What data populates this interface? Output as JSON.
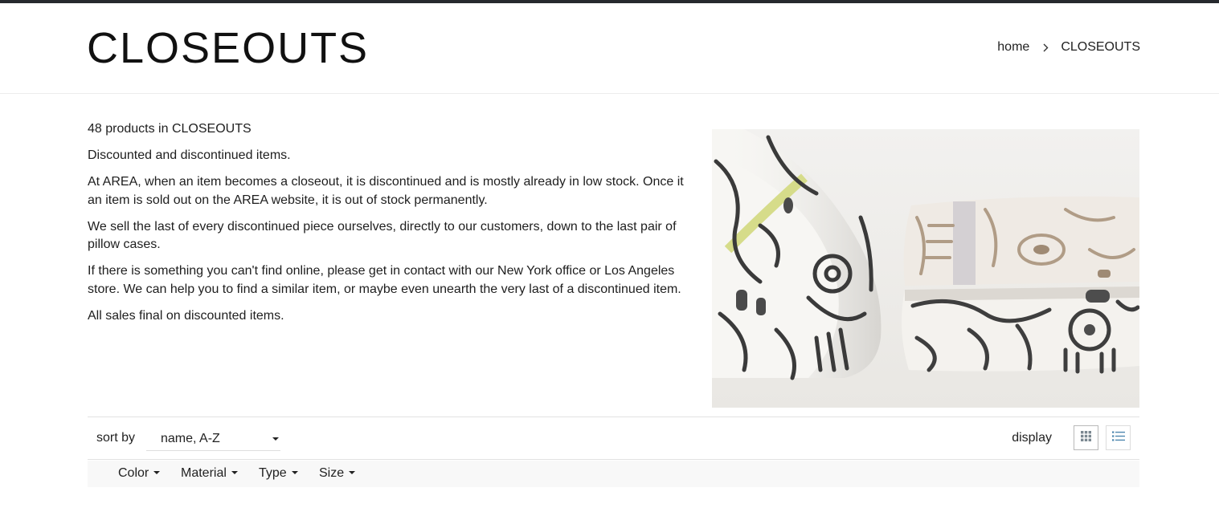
{
  "header": {
    "title": "CLOSEOUTS",
    "breadcrumb": {
      "home": "home",
      "current": "CLOSEOUTS"
    }
  },
  "description": {
    "count_line": "48 products in CLOSEOUTS",
    "paragraphs": [
      "Discounted and discontinued items.",
      "At AREA, when an item becomes a closeout, it is discontinued and is mostly already in low stock.  Once it an item is sold out on the AREA website, it is out of stock permanently.",
      "We sell the last of every discontinued piece ourselves, directly to our customers, down to the last pair of pillow cases.",
      "If there is something you can't find online, please get in contact with our New York office or Los Angeles store. We can help you to find a similar item, or maybe even unearth the very last of a discontinued item.",
      "All sales final on discounted items."
    ]
  },
  "toolbar": {
    "sort_label": "sort by",
    "sort_value": "name, A-Z",
    "display_label": "display",
    "view_icons": [
      "grid-view-icon",
      "list-view-icon"
    ]
  },
  "filters": [
    "Color",
    "Material",
    "Type",
    "Size"
  ],
  "colors": {
    "accent": "#607d8b",
    "topbar": "#26292e",
    "pattern": "#3a3a3a",
    "lime": "#d6dc8a"
  }
}
